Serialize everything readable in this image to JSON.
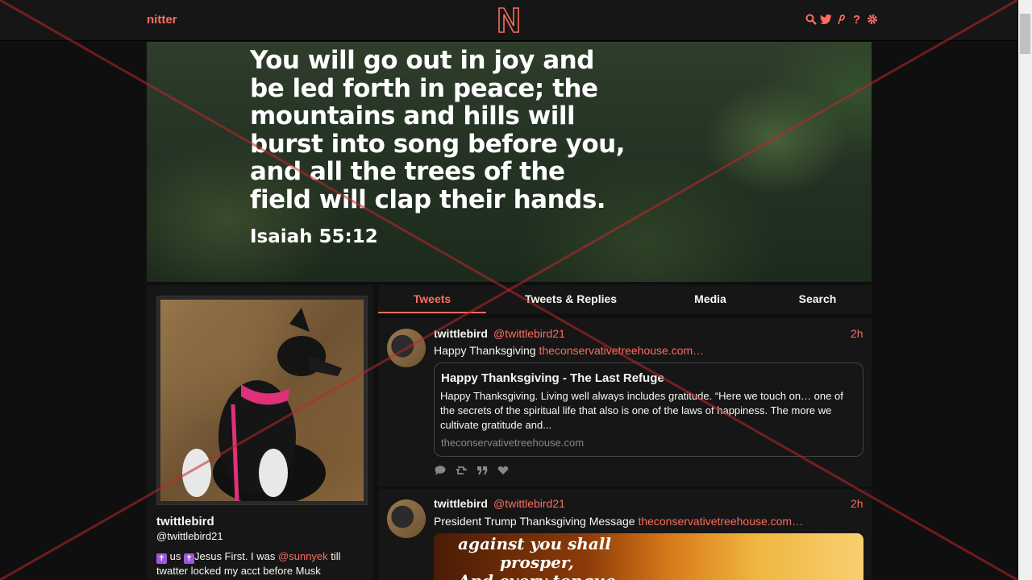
{
  "nav": {
    "brand": "nitter",
    "logo_letter": "N",
    "icons": [
      "search-icon",
      "twitter-icon",
      "rss-icon",
      "help-icon",
      "settings-icon"
    ],
    "help_glyph": "?",
    "accent": "#ff6c60"
  },
  "banner": {
    "lines": [
      "You will go out in joy and",
      "be led forth in peace; the",
      "mountains and hills will",
      "burst into song before you,",
      "and all the trees of the",
      "field will clap their hands."
    ],
    "citation": "Isaiah 55:12"
  },
  "profile": {
    "fullname": "twittlebird",
    "username": "@twittlebird21",
    "bio_part1": "us",
    "bio_part2": "Jesus First. I was",
    "bio_mention": "@sunnyek",
    "bio_part3": "till",
    "bio_line2": "twatter locked my acct before Musk"
  },
  "tabs": [
    {
      "label": "Tweets",
      "active": true
    },
    {
      "label": "Tweets & Replies",
      "active": false
    },
    {
      "label": "Media",
      "active": false
    },
    {
      "label": "Search",
      "active": false
    }
  ],
  "tweets": [
    {
      "fullname": "twittlebird",
      "username": "@twittlebird21",
      "date": "2h",
      "text": "Happy Thanksgiving",
      "link": "theconservativetreehouse.com…",
      "card": {
        "title": "Happy Thanksgiving - The Last Refuge",
        "description": "Happy Thanksgiving. Living well always includes gratitude. “Here we touch on… one of the secrets of the spiritual life that also is one of the laws of happiness. The more we cultivate gratitude and...",
        "destination": "theconservativetreehouse.com"
      }
    },
    {
      "fullname": "twittlebird",
      "username": "@twittlebird21",
      "date": "2h",
      "text": "President Trump Thanksgiving Message",
      "link": "theconservativetreehouse.com…",
      "media_line1": "against you shall",
      "media_line2": "prosper,",
      "media_line3": "And every tongue"
    }
  ]
}
